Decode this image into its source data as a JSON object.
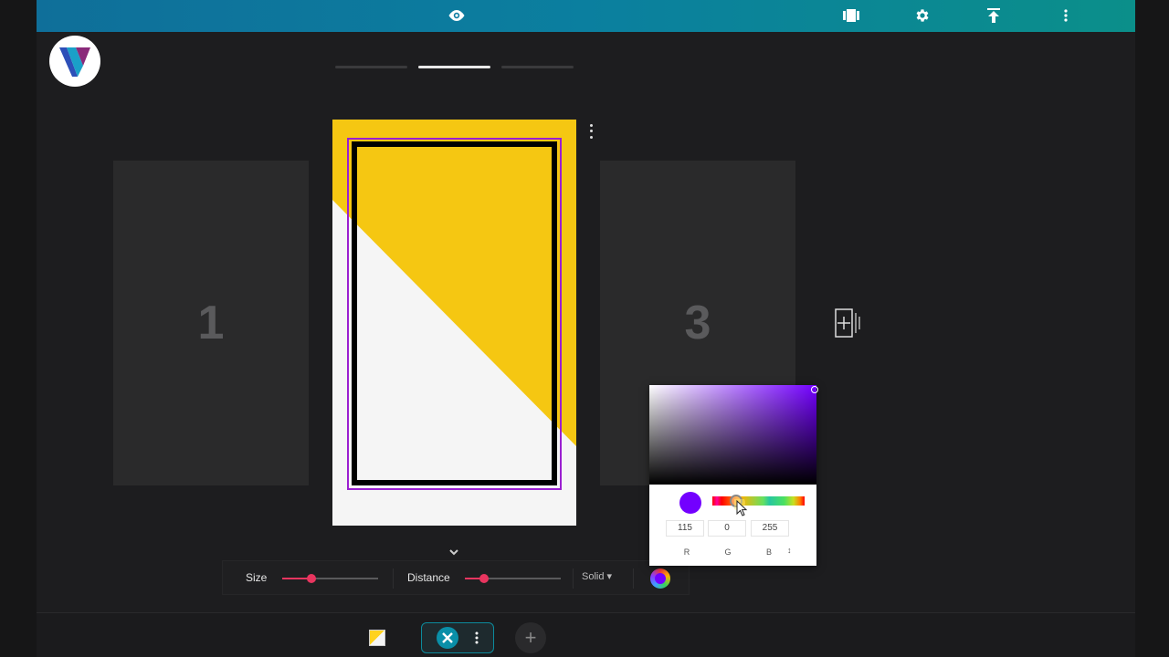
{
  "topbar": {
    "icons": [
      "eye-icon",
      "slides-icon",
      "gear-icon",
      "upload-icon",
      "more-vertical-icon"
    ]
  },
  "slides": {
    "cards": [
      {
        "number": "1"
      },
      {
        "number": "3"
      }
    ],
    "progress_active_index": 1
  },
  "toolbar": {
    "size_label": "Size",
    "size_value": 0.3,
    "distance_label": "Distance",
    "distance_value": 0.2,
    "style_label": "Solid",
    "border_color": "#7300ff"
  },
  "color_picker": {
    "r": "115",
    "g": "0",
    "b": "255",
    "r_label": "R",
    "g_label": "G",
    "b_label": "B",
    "mode_toggle": "↕",
    "hex": "#7300ff"
  },
  "bottombar": {
    "add_label": "+"
  }
}
